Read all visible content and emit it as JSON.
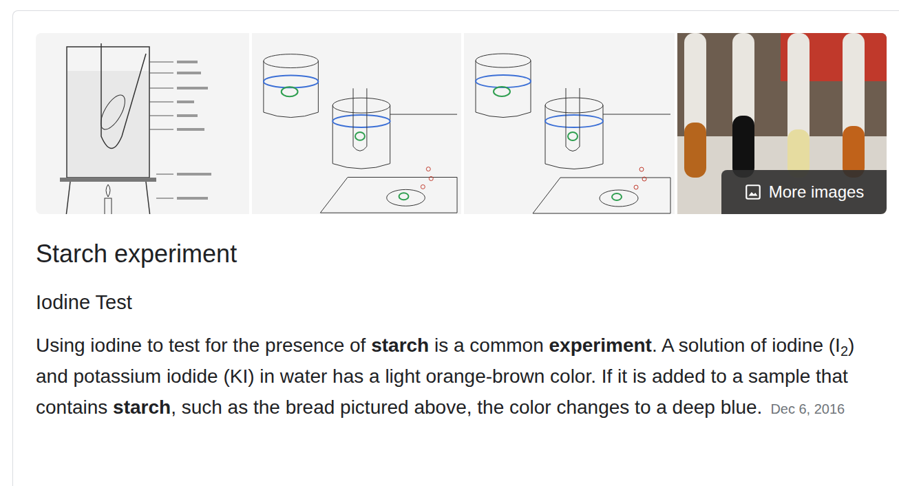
{
  "images": [
    {
      "kind": "apparatus"
    },
    {
      "kind": "steps"
    },
    {
      "kind": "steps"
    },
    {
      "kind": "photo"
    }
  ],
  "more_images": "More images",
  "title": "Starch experiment",
  "subtitle": "Iodine Test",
  "body": [
    {
      "text": "Using iodine to test for the presence of ",
      "bold": false,
      "sub": false
    },
    {
      "text": "starch",
      "bold": true,
      "sub": false
    },
    {
      "text": " is a common ",
      "bold": false,
      "sub": false
    },
    {
      "text": "experiment",
      "bold": true,
      "sub": false
    },
    {
      "text": ". A solution of iodine (I",
      "bold": false,
      "sub": false
    },
    {
      "text": "2",
      "bold": false,
      "sub": true
    },
    {
      "text": ") and potassium iodide (KI) in water has a light orange-brown color. If it is added to a sample that contains ",
      "bold": false,
      "sub": false
    },
    {
      "text": "starch",
      "bold": true,
      "sub": false
    },
    {
      "text": ", such as the bread pictured above, the color changes to a deep blue.",
      "bold": false,
      "sub": false
    }
  ],
  "date": "Dec 6, 2016"
}
